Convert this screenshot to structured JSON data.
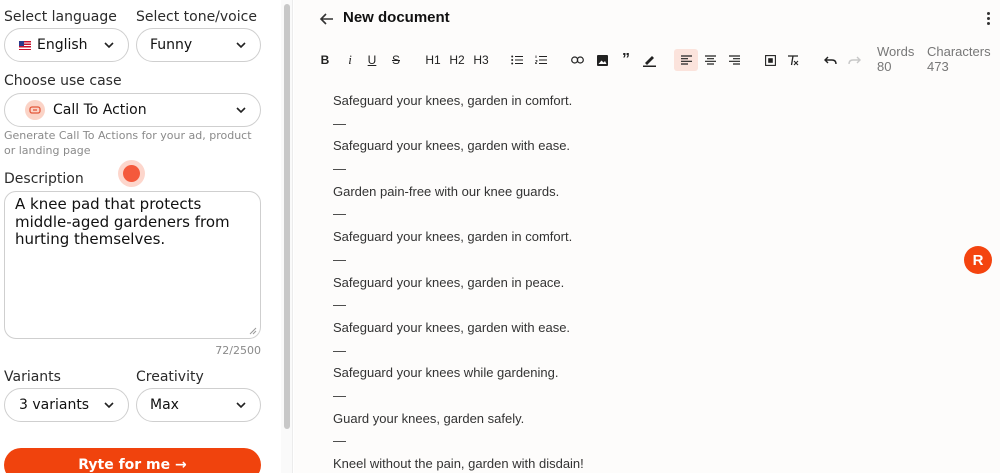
{
  "settings": {
    "language_label": "Select language",
    "language_value": "English",
    "tone_label": "Select tone/voice",
    "tone_value": "Funny",
    "usecase_label": "Choose use case",
    "usecase_value": "Call To Action",
    "usecase_helper": "Generate Call To Actions for your ad, product or landing page",
    "description_label": "Description",
    "description_value": "A knee pad that protects middle-aged gardeners from hurting themselves.",
    "char_counter": "72/2500",
    "variants_label": "Variants",
    "variants_value": "3 variants",
    "creativity_label": "Creativity",
    "creativity_value": "Max",
    "submit_label": "Ryte for me →"
  },
  "editor": {
    "title": "New document",
    "toolbar": {
      "bold": "B",
      "italic": "i",
      "underline": "U",
      "strike": "S",
      "h1": "H1",
      "h2": "H2",
      "h3": "H3",
      "quote": "”"
    },
    "words_label": "Words",
    "words_value": "80",
    "chars_label": "Characters",
    "chars_value": "473",
    "lines": [
      "Safeguard your knees, garden in comfort.",
      "—",
      "Safeguard your knees, garden with ease.",
      "—",
      "Garden pain-free with our knee guards.",
      "—",
      "Safeguard your knees, garden in comfort.",
      "—",
      "Safeguard your knees, garden in peace.",
      "—",
      "Safeguard your knees, garden with ease.",
      "—",
      "Safeguard your knees while gardening.",
      "—",
      "Guard your knees, garden safely.",
      "—",
      "Kneel without the pain, garden with disdain!"
    ],
    "badge": "R"
  },
  "colors": {
    "accent": "#f0430d",
    "active_bg": "#fbe3dc"
  },
  "icons": [
    "chevron-down-icon",
    "flag-us-icon",
    "record-icon",
    "arrow-left-icon",
    "more-vertical-icon",
    "bullet-list-icon",
    "numbered-list-icon",
    "link-icon",
    "image-icon",
    "quote-icon",
    "highlight-icon",
    "align-left-icon",
    "align-center-icon",
    "align-right-icon",
    "focus-icon",
    "clear-format-icon",
    "undo-icon",
    "redo-icon"
  ]
}
